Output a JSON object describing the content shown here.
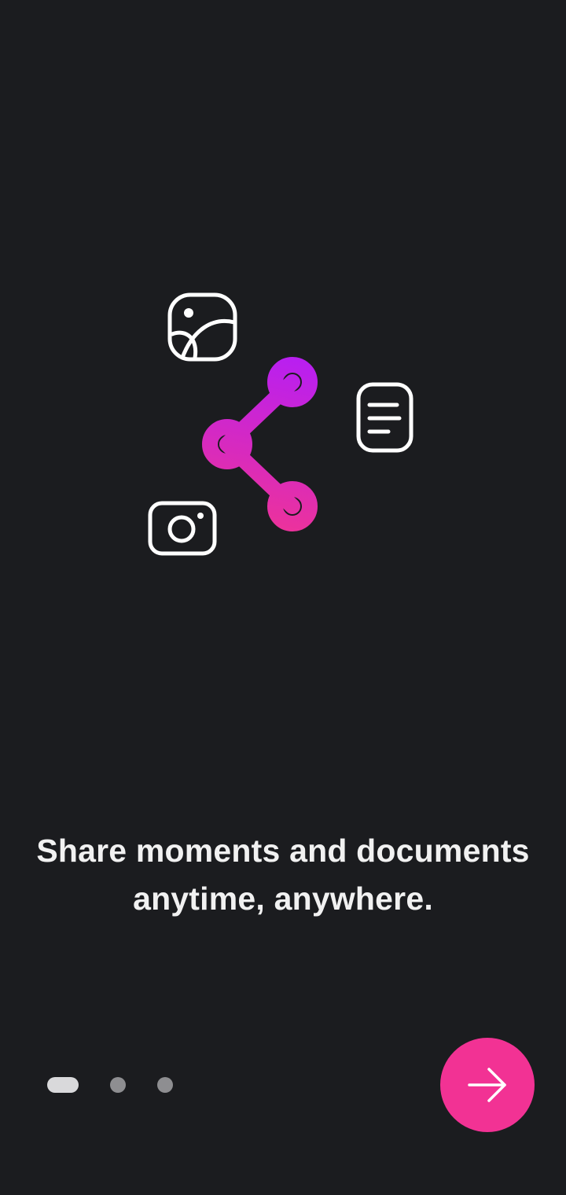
{
  "onboarding": {
    "headline_line1": "Share moments and documents",
    "headline_line2": "anytime, anywhere.",
    "page_count": 3,
    "current_page": 1
  },
  "illustration": {
    "icons": [
      "gallery-icon",
      "share-icon",
      "document-icon",
      "camera-icon"
    ],
    "share_gradient": [
      "#b91ff0",
      "#ef3397"
    ],
    "outline_color": "#ffffff"
  },
  "next_button": {
    "icon": "arrow-right-icon",
    "color": "#f23294"
  }
}
